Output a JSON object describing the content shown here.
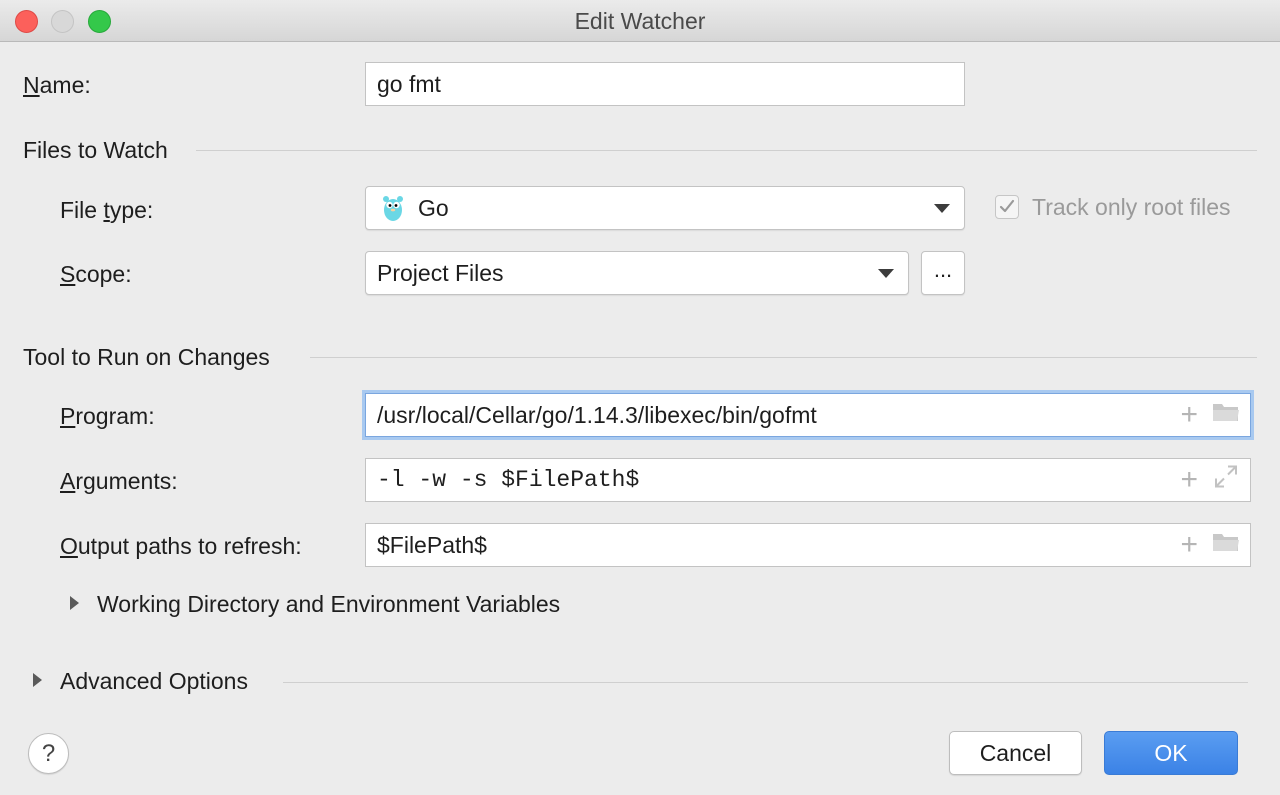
{
  "window": {
    "title": "Edit Watcher"
  },
  "name": {
    "label_u": "N",
    "label_rest": "ame:",
    "value": "go fmt"
  },
  "files_to_watch": {
    "title": "Files to Watch",
    "file_type": {
      "label_pre": "File ",
      "label_u": "t",
      "label_rest": "ype:",
      "value": "Go",
      "icon": "gopher-icon"
    },
    "track_root": {
      "label": "Track only root files",
      "checked": true
    },
    "scope": {
      "label_u": "S",
      "label_rest": "cope:",
      "value": "Project Files",
      "more_label": "..."
    }
  },
  "tool": {
    "title": "Tool to Run on Changes",
    "program": {
      "label_u": "P",
      "label_rest": "rogram:",
      "value": "/usr/local/Cellar/go/1.14.3/libexec/bin/gofmt"
    },
    "arguments": {
      "label_u": "A",
      "label_rest": "rguments:",
      "value": "-l -w -s $FilePath$"
    },
    "output": {
      "label_u": "O",
      "label_rest": "utput paths to refresh:",
      "value": "$FilePath$"
    },
    "working_dir": {
      "label": "Working Directory and Environment Variables"
    }
  },
  "advanced": {
    "label": "Advanced Options"
  },
  "buttons": {
    "help": "?",
    "cancel": "Cancel",
    "ok": "OK"
  },
  "colors": {
    "accent": "#3b82e6",
    "focus": "#a8c9f0"
  }
}
